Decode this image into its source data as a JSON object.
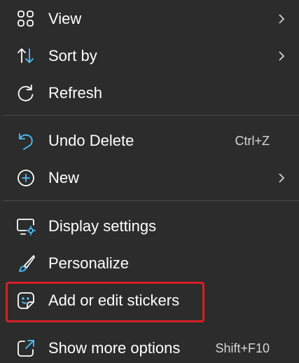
{
  "menu": {
    "items": [
      {
        "label": "View",
        "icon": "grid-icon",
        "submenu": true
      },
      {
        "label": "Sort by",
        "icon": "sort-icon",
        "submenu": true
      },
      {
        "label": "Refresh",
        "icon": "refresh-icon"
      },
      {
        "label": "Undo Delete",
        "icon": "undo-icon",
        "shortcut": "Ctrl+Z"
      },
      {
        "label": "New",
        "icon": "new-icon",
        "submenu": true
      },
      {
        "label": "Display settings",
        "icon": "display-settings-icon"
      },
      {
        "label": "Personalize",
        "icon": "brush-icon"
      },
      {
        "label": "Add or edit stickers",
        "icon": "sticker-icon"
      },
      {
        "label": "Show more options",
        "icon": "more-options-icon",
        "shortcut": "Shift+F10"
      }
    ]
  },
  "colors": {
    "background": "#2c2c2c",
    "text": "#ffffff",
    "accent": "#4cc2ff",
    "highlight_border": "#d81f26"
  }
}
